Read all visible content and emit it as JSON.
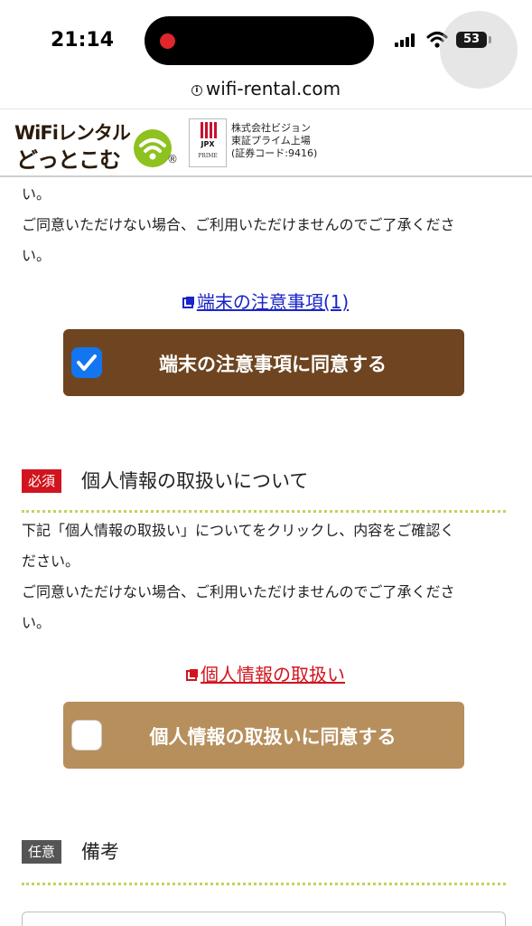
{
  "status": {
    "time": "21:14",
    "battery": "53"
  },
  "browser": {
    "url": "wifi-rental.com",
    "info_icon": "i"
  },
  "header": {
    "logo_line1": "WiFiレンタル",
    "logo_line2": "どっとこむ",
    "registered": "®",
    "jpx_label": "JPX",
    "jpx_prime": "PRIME",
    "company_lines": [
      "株式会社ビジョン",
      "東証プライム上場",
      "(証券コード:9416)"
    ]
  },
  "section1": {
    "para_lines": [
      "い。",
      "ご同意いただけない場合、ご利用いただけませんのでご了承くださ",
      "い。"
    ],
    "link_label": "端末の注意事項(1)",
    "agree_label": "端末の注意事項に同意する",
    "agree_checked": true
  },
  "section2": {
    "badge": "必須",
    "title": "個人情報の取扱いについて",
    "para_lines": [
      "下記「個人情報の取扱い」についてをクリックし、内容をご確認く",
      "ださい。",
      "ご同意いただけない場合、ご利用いただけませんのでご了承くださ",
      "い。"
    ],
    "link_label": "個人情報の取扱い",
    "agree_label": "個人情報の取扱いに同意する",
    "agree_checked": false
  },
  "section3": {
    "badge": "任意",
    "title": "備考"
  },
  "colors": {
    "brown_button": "#6e4520",
    "tan_button": "#b68f5c",
    "required_badge": "#d2141e",
    "optional_badge": "#555555",
    "link_blue": "#1a24c8",
    "link_red": "#d2141e",
    "checkbox_blue": "#1475f0"
  }
}
